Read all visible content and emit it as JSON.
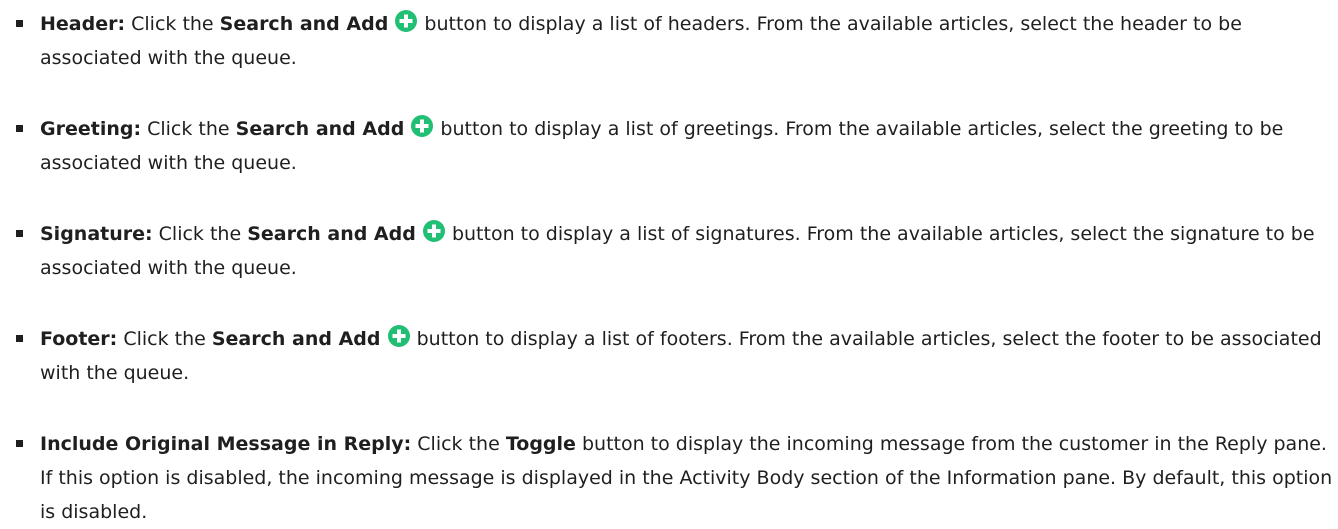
{
  "icons": {
    "search_add": "plus-circle-icon",
    "search_add_color": "#21bf73"
  },
  "items": [
    {
      "label": "Header:",
      "text1": "Click the",
      "action": "Search and Add",
      "text2": "button to display a list of headers. From the available articles, select the header to be associated with the queue."
    },
    {
      "label": "Greeting:",
      "text1": "Click the",
      "action": "Search and Add",
      "text2": "button to display a list of greetings. From the available articles, select the greeting to be associated with the queue."
    },
    {
      "label": "Signature:",
      "text1": "Click the",
      "action": "Search and Add",
      "text2": "button to display a list of signatures. From the available articles, select the signature to be associated with the queue."
    },
    {
      "label": "Footer:",
      "text1": "Click the",
      "action": "Search and Add",
      "text2": "button to display a list of footers. From the available articles, select the footer to be associated with the queue."
    },
    {
      "label": "Include Original Message in Reply:",
      "text1": "Click the",
      "action": "Toggle",
      "text2": "button to display the incoming message from the customer in the Reply pane. If this option is disabled, the incoming message is displayed in the Activity Body section of the Information pane. By default, this option is disabled."
    }
  ]
}
